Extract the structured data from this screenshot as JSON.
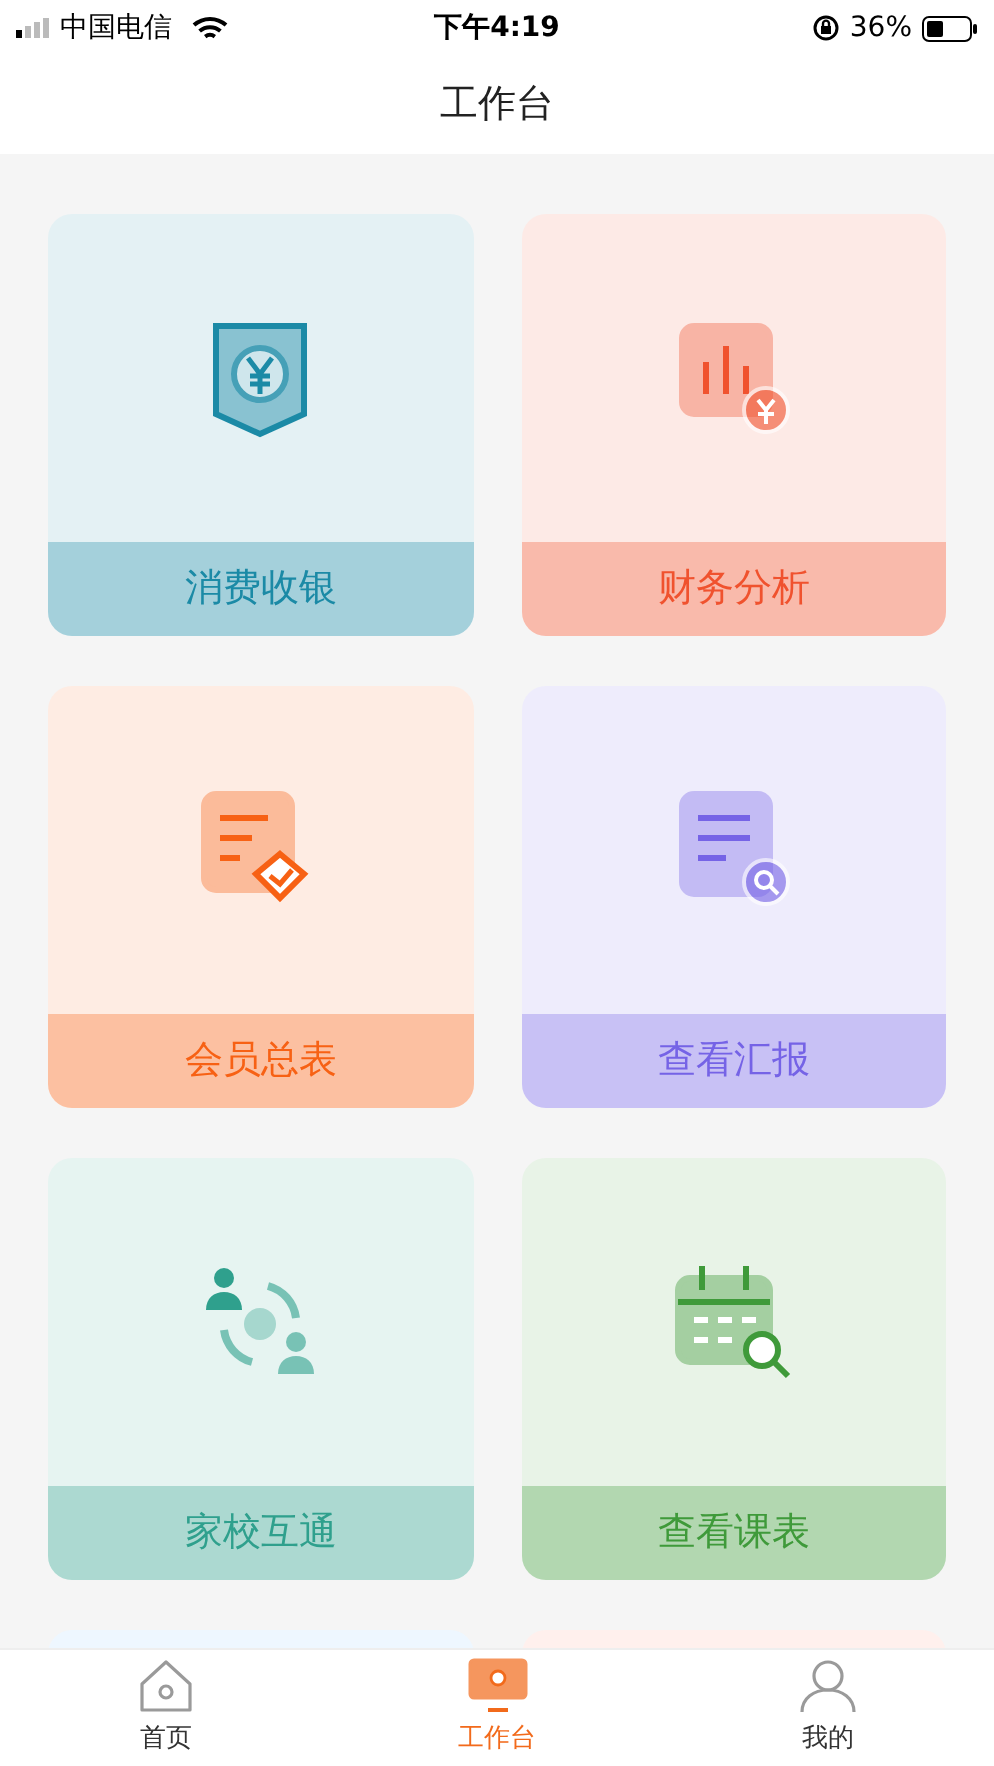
{
  "status_bar": {
    "carrier": "中国电信",
    "time": "下午4:19",
    "battery": "36%"
  },
  "header": {
    "title": "工作台"
  },
  "cards": [
    {
      "kind": "cashier",
      "label": "消费收银",
      "color": "#1b8aa6"
    },
    {
      "kind": "analysis",
      "label": "财务分析",
      "color": "#f0522e"
    },
    {
      "kind": "member",
      "label": "会员总表",
      "color": "#f76114"
    },
    {
      "kind": "report",
      "label": "查看汇报",
      "color": "#7563e6"
    },
    {
      "kind": "contact",
      "label": "家校互通",
      "color": "#2fa08d"
    },
    {
      "kind": "schedule",
      "label": "查看课表",
      "color": "#3f9a3a"
    },
    {
      "kind": "cut-off",
      "color": "#eef7ff"
    },
    {
      "kind": "cut-off",
      "color": "#fff0ed"
    }
  ],
  "tabs": [
    {
      "kind": "home",
      "label": "首页",
      "selected": false
    },
    {
      "kind": "workbench",
      "label": "工作台",
      "selected": true
    },
    {
      "kind": "profile",
      "label": "我的",
      "selected": false
    }
  ]
}
